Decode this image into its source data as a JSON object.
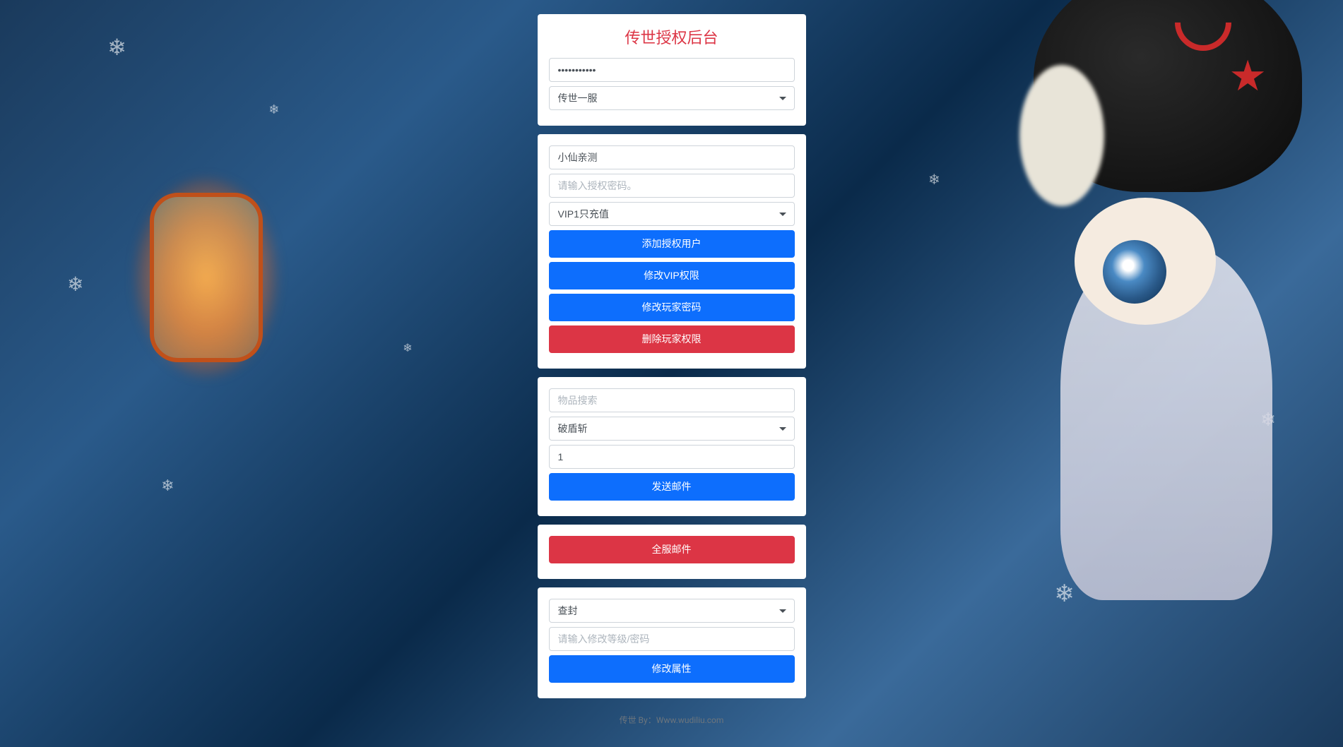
{
  "header": {
    "title": "传世授权后台"
  },
  "section1": {
    "password_value": "•••••••••••",
    "server_select": "传世一服"
  },
  "section2": {
    "username_value": "小仙亲测",
    "auth_password_placeholder": "请输入授权密码。",
    "vip_select": "VIP1只充值",
    "btn_add_user": "添加授权用户",
    "btn_modify_vip": "修改VIP权限",
    "btn_modify_password": "修改玩家密码",
    "btn_delete_permission": "删除玩家权限"
  },
  "section3": {
    "item_search_placeholder": "物品搜索",
    "item_select": "破盾斩",
    "quantity_value": "1",
    "btn_send_mail": "发送邮件"
  },
  "section4": {
    "btn_global_mail": "全服邮件"
  },
  "section5": {
    "action_select": "查封",
    "level_password_placeholder": "请输入修改等级/密码",
    "btn_modify_attr": "修改属性"
  },
  "footer": {
    "text": "传世 By：Www.wudiliu.com"
  }
}
